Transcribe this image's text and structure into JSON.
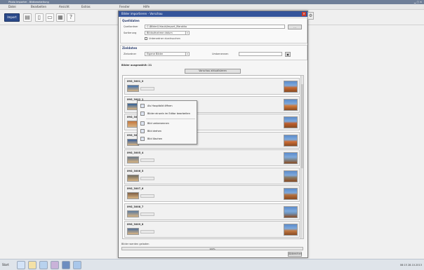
{
  "app": {
    "window_title": "Photo Importer - Bildbearbeitung",
    "menu": [
      "Datei",
      "Bearbeiten",
      "Ansicht",
      "Extras",
      "Fenster",
      "Hilfe"
    ],
    "toolbar_primary": "Import"
  },
  "dialog": {
    "title": "Bilder importieren - Vorschau",
    "source_section": "Quelldaten",
    "source_path_label": "Quellordner",
    "source_path": "C:\\Bilder\\Urlaub\\Import_Marokko",
    "source_sort_label": "Sortierung",
    "source_sort": "Bildaufnahme datum",
    "include_sub_label": "Unterordner durchsuchen",
    "target_section": "Zieldaten",
    "target_label": "Zielordner",
    "target_value": "Eigene Bilder",
    "target_rename_label": "Umbenennen",
    "target_rename_value": "",
    "count_label": "Bilder ausgewählt: 21",
    "load_button": "Vorschau aktualisieren",
    "status_label": "Bilder werden geladen",
    "progress_text": "100%",
    "cancel_button": "Abbrechen"
  },
  "photos": [
    {
      "name": "IMG_3001_0",
      "thumb_color": "#3b6fb0",
      "preview_color": "#c96a2f"
    },
    {
      "name": "IMG_3002_1",
      "thumb_color": "#2e5f99",
      "preview_color": "#d47b3a"
    },
    {
      "name": "IMG_3003_2",
      "thumb_color": "#c4763d",
      "preview_color": "#bf5d2b"
    },
    {
      "name": "IMG_3004_3",
      "thumb_color": "#355e9a",
      "preview_color": "#cf6e34"
    },
    {
      "name": "IMG_3005_4",
      "thumb_color": "#6b7a8a",
      "preview_color": "#7c8f9f"
    },
    {
      "name": "IMG_3006_5",
      "thumb_color": "#6e6a5d",
      "preview_color": "#8a7a64"
    },
    {
      "name": "IMG_3007_6",
      "thumb_color": "#7f5f44",
      "preview_color": "#b6703c"
    },
    {
      "name": "IMG_3008_7",
      "thumb_color": "#5d7c9f",
      "preview_color": "#6f94bd"
    },
    {
      "name": "IMG_3009_8",
      "thumb_color": "#4f6f98",
      "preview_color": "#c27a43"
    }
  ],
  "context_menu": [
    "Als Hauptbild öffnen",
    "Bilder einzeln im Editor bearbeiten",
    "Bild umbenennen",
    "Bild drehen",
    "Bild löschen"
  ],
  "taskbar": {
    "start": "Start",
    "clock": "08:15  28.10.2013"
  }
}
